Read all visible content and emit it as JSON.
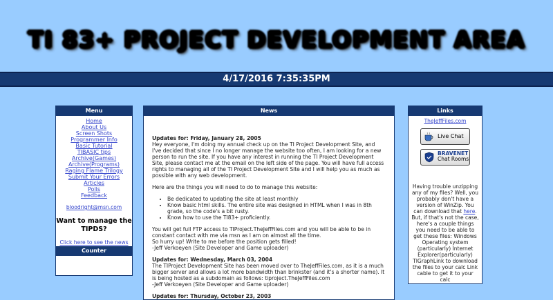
{
  "banner": {
    "title": "TI 83+ PROJECT DEVELOPMENT AREA"
  },
  "datetime": "4/17/2016 7:35:35PM",
  "menu": {
    "heading": "Menu",
    "items": [
      "Home",
      "About Us",
      "Screen Shots",
      "Programmer Info",
      "Basic Tutorial",
      "TIBASIC tips",
      "Archive(Games)",
      "Archive(Programs)",
      "Raging Flame Trilogy",
      "Submit Your Errors",
      "Articles",
      "Polls",
      "Feedback"
    ],
    "email": "bloodright@msn.com",
    "manage_heading": "Want to manage the TIPDS?",
    "manage_link": "Click here to see the news",
    "counter_heading": "Counter"
  },
  "news": {
    "heading": "News",
    "updates": [
      {
        "label": "Updates for: ",
        "date": "Friday, January 28, 2005",
        "p1": "Hey everyone, I'm doing my annual check up on the TI Project Development Site, and I've decided that since I no longer manage the website too often, I am looking for a new person to run the site. If you have any interest in running the TI Project Development Site, please contact me at the email on the left side of the page. You will have full access rights to managing all of the TI Project Development Site and I will help you as much as possible with any web development.",
        "p2": "Here are the things you will need to do to manage this website:",
        "bullets": [
          "Be dedicated to updating the site at least monthly",
          "Know basic html skills. The entire site was designed in HTML when I was in 8th grade, so the code's a bit rusty.",
          "Know how to use the TI83+ proficiently."
        ],
        "p3": "You will get full FTP access to TIProject.TheJeffFiles.com and you will be able to be in constant contact with me via msn as I am on almost all the time.",
        "p4": "So hurry up! Write to me before the position gets filled!",
        "sign": "-Jeff Verkoeyen (Site Developer and Game uploader)"
      },
      {
        "label": "Updates for: ",
        "date": "Wednesday, March 03, 2004",
        "p1": "The TIProject Development Site has been moved over to TheJeffFiles.com, as it is a much bigger server and allows a lot more bandwidth than brinkster (and it's a shorter name). It is being hosted as a subdomain as follows: tiproject.TheJeffFiles.com",
        "sign": "-Jeff Verkoeyen (Site Developer and Game uploader)"
      },
      {
        "label": "Updates for: ",
        "date": "Thursday, October 23, 2003"
      }
    ]
  },
  "links": {
    "heading": "Links",
    "site": "TheJeffFiles.com",
    "live_chat": "Live Chat",
    "bravenet_brand": "BRAVENET",
    "bravenet_rooms": "Chat Rooms",
    "winzip_text_1": "Having trouble unzipping any of my files? Well, you probably don't have a version of WinZip. You can download that ",
    "winzip_link": "here",
    "winzip_text_2": ". But, if that's not the case, here's a couple things you need to be able to get these files: Windows Operating system (particularly) Internet Explorer(particularly) TIGraphLink to download the files to your calc Link cable to get it to your calc"
  }
}
